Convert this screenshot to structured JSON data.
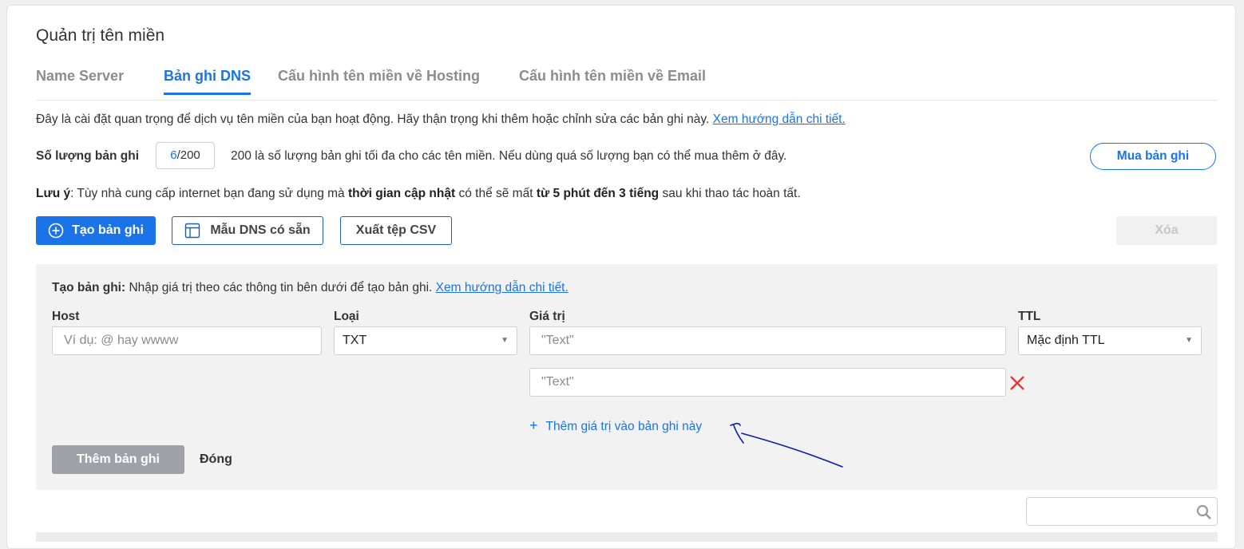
{
  "page": {
    "title": "Quản trị tên miền"
  },
  "tabs": [
    {
      "label": "Name Server",
      "active": false
    },
    {
      "label": "Bản ghi DNS",
      "active": true
    },
    {
      "label": "Cấu hình tên miền về Hosting",
      "active": false
    },
    {
      "label": "Cấu hình tên miền về Email",
      "active": false
    }
  ],
  "info": {
    "text": "Đây là cài đặt quan trọng để dịch vụ tên miền của bạn hoạt động. Hãy thận trọng khi thêm hoặc chỉnh sửa các bản ghi này. ",
    "link": "Xem hướng dẫn chi tiết."
  },
  "record_count": {
    "label": "Số lượng bản ghi",
    "current": "6",
    "max": "/200",
    "description": "200 là số lượng bản ghi tối đa cho các tên miền. Nếu dùng quá số lượng bạn có thể mua thêm ở đây.",
    "buy_button": "Mua bản ghi"
  },
  "note": {
    "label": "Lưu ý",
    "part1": ": Tùy nhà cung cấp internet bạn đang sử dụng mà ",
    "bold1": "thời gian cập nhật",
    "part2": " có thể sẽ mất ",
    "bold2": "từ 5 phút đến 3 tiếng",
    "part3": " sau khi thao tác hoàn tất."
  },
  "toolbar": {
    "create": "Tạo bản ghi",
    "template": "Mẫu DNS có sẵn",
    "export": "Xuất tệp CSV",
    "delete": "Xóa"
  },
  "form": {
    "hint_label": "Tạo bản ghi:",
    "hint_text": " Nhập giá trị theo các thông tin bên dưới để tạo bản ghi. ",
    "hint_link": "Xem hướng dẫn chi tiết.",
    "host_label": "Host",
    "host_placeholder": "Ví dụ: @ hay wwww",
    "type_label": "Loại",
    "type_value": "TXT",
    "value_label": "Giá trị",
    "value1": "\"Text\"",
    "value2": "\"Text\"",
    "ttl_label": "TTL",
    "ttl_value": "Mặc định TTL",
    "add_value_link": "Thêm giá trị vào bản ghi này",
    "submit": "Thêm bản ghi",
    "close": "Đóng"
  },
  "colors": {
    "accent": "#1b73e8",
    "danger": "#e53935",
    "annotation": "#0b1fa8"
  }
}
